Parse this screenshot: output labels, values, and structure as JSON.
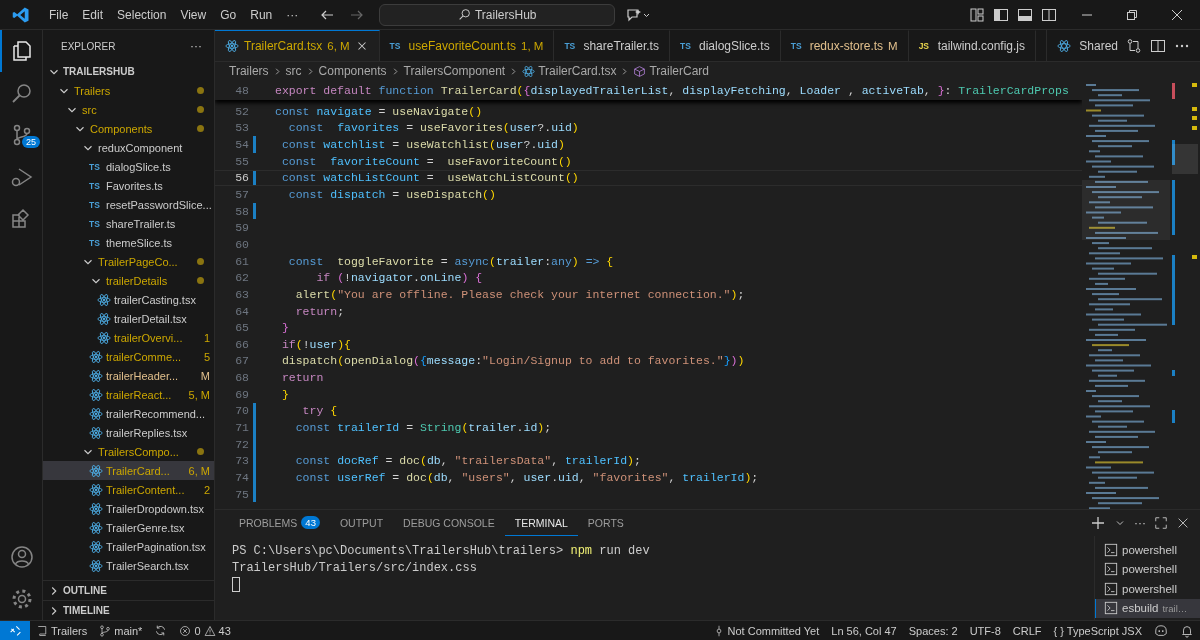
{
  "titlebar": {
    "menu": [
      "File",
      "Edit",
      "Selection",
      "View",
      "Go",
      "Run",
      "···"
    ],
    "search": "TrailersHub"
  },
  "activity": {
    "top": [
      {
        "kind": "explorer",
        "selected": true
      },
      {
        "kind": "search",
        "selected": false
      },
      {
        "kind": "scm",
        "selected": false,
        "badge": "25"
      },
      {
        "kind": "debug",
        "selected": false
      },
      {
        "kind": "extensions",
        "selected": false
      }
    ],
    "bottom": [
      {
        "kind": "account"
      },
      {
        "kind": "settings"
      }
    ]
  },
  "explorer": {
    "title": "EXPLORER",
    "more": "···",
    "root": {
      "label": "TRAILERSHUB",
      "expanded": true
    },
    "tree": [
      {
        "label": "Trailers",
        "kind": "folder",
        "expanded": true,
        "errors": true,
        "dot": true,
        "selected": false,
        "children": [
          {
            "label": "src",
            "kind": "folder",
            "expanded": true,
            "errors": true,
            "dot": true,
            "selected": false,
            "children": [
              {
                "label": "Components",
                "kind": "folder",
                "expanded": true,
                "errors": true,
                "dot": true,
                "selected": false,
                "children": [
                  {
                    "label": "reduxComponent",
                    "kind": "folder",
                    "expanded": true,
                    "errors": false,
                    "modified": false,
                    "dot": false,
                    "selected": false,
                    "children": [
                      {
                        "label": "dialogSlice.ts",
                        "kind": "ts",
                        "icon": "TS",
                        "errors": false,
                        "modified": false,
                        "selected": false
                      },
                      {
                        "label": "Favorites.ts",
                        "kind": "ts",
                        "icon": "TS",
                        "errors": false,
                        "modified": false,
                        "selected": false
                      },
                      {
                        "label": "resetPasswordSlice...",
                        "kind": "ts",
                        "icon": "TS",
                        "errors": false,
                        "modified": false,
                        "selected": false
                      },
                      {
                        "label": "shareTrailer.ts",
                        "kind": "ts",
                        "icon": "TS",
                        "errors": false,
                        "modified": false,
                        "selected": false
                      },
                      {
                        "label": "themeSlice.ts",
                        "kind": "ts",
                        "icon": "TS",
                        "errors": false,
                        "modified": false,
                        "selected": false
                      }
                    ]
                  },
                  {
                    "label": "TrailerPageCo...",
                    "kind": "folder",
                    "expanded": true,
                    "errors": true,
                    "dot": true,
                    "selected": false,
                    "children": [
                      {
                        "label": "trailerDetails",
                        "kind": "folder",
                        "expanded": true,
                        "errors": true,
                        "dot": true,
                        "selected": false,
                        "children": [
                          {
                            "label": "trailerCasting.tsx",
                            "kind": "react",
                            "errors": false,
                            "modified": false,
                            "selected": false
                          },
                          {
                            "label": "trailerDetail.tsx",
                            "kind": "react",
                            "errors": false,
                            "modified": false,
                            "selected": false
                          },
                          {
                            "label": "trailerOvervi...",
                            "kind": "react",
                            "errors": true,
                            "badge": "1",
                            "selected": false
                          }
                        ]
                      },
                      {
                        "label": "trailerComme...",
                        "kind": "react",
                        "errors": true,
                        "badge": "5",
                        "selected": false
                      },
                      {
                        "label": "trailerHeader...",
                        "kind": "react",
                        "errors": false,
                        "modified": true,
                        "badge": "M",
                        "selected": false
                      },
                      {
                        "label": "trailerReact...",
                        "kind": "react",
                        "errors": true,
                        "badge": "5, M",
                        "selected": false
                      },
                      {
                        "label": "trailerRecommend...",
                        "kind": "react",
                        "errors": false,
                        "modified": false,
                        "selected": false
                      },
                      {
                        "label": "trailerReplies.tsx",
                        "kind": "react",
                        "errors": false,
                        "modified": false,
                        "selected": false
                      }
                    ]
                  },
                  {
                    "label": "TrailersCompo...",
                    "kind": "folder",
                    "expanded": true,
                    "errors": true,
                    "dot": true,
                    "selected": false,
                    "children": [
                      {
                        "label": "TrailerCard...",
                        "kind": "react",
                        "errors": true,
                        "badge": "6, M",
                        "selected": true
                      },
                      {
                        "label": "TrailerContent...",
                        "kind": "react",
                        "errors": true,
                        "badge": "2",
                        "selected": false
                      },
                      {
                        "label": "TrailerDropdown.tsx",
                        "kind": "react",
                        "errors": false,
                        "modified": false,
                        "selected": false
                      },
                      {
                        "label": "TrailerGenre.tsx",
                        "kind": "react",
                        "errors": false,
                        "modified": false,
                        "selected": false
                      },
                      {
                        "label": "TrailerPagination.tsx",
                        "kind": "react",
                        "errors": false,
                        "modified": false,
                        "selected": false
                      },
                      {
                        "label": "TrailerSearch.tsx",
                        "kind": "react",
                        "errors": false,
                        "modified": false,
                        "selected": false
                      }
                    ]
                  }
                ]
              }
            ]
          }
        ]
      }
    ],
    "sections": [
      {
        "label": "OUTLINE",
        "expanded": false
      },
      {
        "label": "TIMELINE",
        "expanded": false
      }
    ]
  },
  "tabs": [
    {
      "label": "TrailerCard.tsx",
      "kind": "react",
      "badge": "6, M",
      "errors": true,
      "selected": true
    },
    {
      "label": "useFavoriteCount.ts",
      "kind": "ts",
      "icon": "TS",
      "badge": "1, M",
      "errors": true,
      "selected": false
    },
    {
      "label": "shareTrailer.ts",
      "kind": "ts",
      "icon": "TS",
      "errors": false,
      "modified": false,
      "selected": false
    },
    {
      "label": "dialogSlice.ts",
      "kind": "ts",
      "icon": "TS",
      "errors": false,
      "modified": false,
      "selected": false
    },
    {
      "label": "redux-store.ts",
      "kind": "ts",
      "icon": "TS",
      "badge": "M",
      "errors": false,
      "modified": true,
      "selected": false
    },
    {
      "label": "tailwind.config.js",
      "kind": "js",
      "icon": "JS",
      "errors": false,
      "modified": false,
      "selected": false
    }
  ],
  "shared": "Shared",
  "breadcrumbs": [
    {
      "label": "Trailers",
      "kind": "plain"
    },
    {
      "label": "src",
      "kind": "plain"
    },
    {
      "label": "Components",
      "kind": "plain"
    },
    {
      "label": "TrailersComponent",
      "kind": "plain"
    },
    {
      "label": "TrailerCard.tsx",
      "kind": "react"
    },
    {
      "label": "TrailerCard",
      "kind": "symbol"
    }
  ],
  "code": {
    "sticky": {
      "n": "48",
      "tokens": [
        {
          "kind": "ctrl",
          "text": "export default "
        },
        {
          "kind": "kw",
          "text": "function "
        },
        {
          "kind": "fn",
          "text": "TrailerCard"
        },
        {
          "kind": "br1",
          "text": "("
        },
        {
          "kind": "br2",
          "text": "{"
        },
        {
          "kind": "var",
          "text": "displayedTrailerList"
        },
        {
          "kind": "plain",
          "text": ", "
        },
        {
          "kind": "var",
          "text": "displayFetching"
        },
        {
          "kind": "plain",
          "text": ", "
        },
        {
          "kind": "var",
          "text": "Loader "
        },
        {
          "kind": "plain",
          "text": ", "
        },
        {
          "kind": "var",
          "text": "activeTab"
        },
        {
          "kind": "plain",
          "text": ", "
        },
        {
          "kind": "br2",
          "text": "}"
        },
        {
          "kind": "plain",
          "text": ": "
        },
        {
          "kind": "type",
          "text": "TrailerCardProps"
        }
      ]
    },
    "lines": [
      {
        "n": "52",
        "current": false,
        "changed": false,
        "tokens": [
          {
            "kind": "kw",
            "text": "const "
          },
          {
            "kind": "const",
            "text": "navigate"
          },
          {
            "kind": "plain",
            "text": " = "
          },
          {
            "kind": "fn",
            "text": "useNavigate"
          },
          {
            "kind": "br1",
            "text": "()"
          }
        ]
      },
      {
        "n": "53",
        "current": false,
        "changed": false,
        "tokens": [
          {
            "kind": "kw",
            "text": "  const  "
          },
          {
            "kind": "const",
            "text": "favorites"
          },
          {
            "kind": "plain",
            "text": " = "
          },
          {
            "kind": "fn",
            "text": "useFavorites"
          },
          {
            "kind": "br1",
            "text": "("
          },
          {
            "kind": "var",
            "text": "user"
          },
          {
            "kind": "plain",
            "text": "?."
          },
          {
            "kind": "var",
            "text": "uid"
          },
          {
            "kind": "br1",
            "text": ")"
          }
        ]
      },
      {
        "n": "54",
        "current": false,
        "changed": true,
        "tokens": [
          {
            "kind": "kw",
            "text": " const "
          },
          {
            "kind": "const",
            "text": "watchlist"
          },
          {
            "kind": "plain",
            "text": " = "
          },
          {
            "kind": "fn",
            "text": "useWatchlist"
          },
          {
            "kind": "br1",
            "text": "("
          },
          {
            "kind": "var",
            "text": "user"
          },
          {
            "kind": "plain",
            "text": "?."
          },
          {
            "kind": "var",
            "text": "uid"
          },
          {
            "kind": "br1",
            "text": ")"
          }
        ]
      },
      {
        "n": "55",
        "current": false,
        "changed": false,
        "tokens": [
          {
            "kind": "kw",
            "text": " const  "
          },
          {
            "kind": "const",
            "text": "favoriteCount"
          },
          {
            "kind": "plain",
            "text": " =  "
          },
          {
            "kind": "fn",
            "text": "useFavoriteCount"
          },
          {
            "kind": "br1",
            "text": "()"
          }
        ]
      },
      {
        "n": "56",
        "current": true,
        "changed": true,
        "tokens": [
          {
            "kind": "kw",
            "text": " const "
          },
          {
            "kind": "const",
            "text": "watchListCount"
          },
          {
            "kind": "plain",
            "text": " =  "
          },
          {
            "kind": "fn",
            "text": "useWatchListCount"
          },
          {
            "kind": "br1",
            "text": "()"
          }
        ]
      },
      {
        "n": "57",
        "current": false,
        "changed": false,
        "tokens": [
          {
            "kind": "kw",
            "text": "  const "
          },
          {
            "kind": "const",
            "text": "dispatch"
          },
          {
            "kind": "plain",
            "text": " = "
          },
          {
            "kind": "fn",
            "text": "useDispatch"
          },
          {
            "kind": "br1",
            "text": "()"
          }
        ]
      },
      {
        "n": "58",
        "current": false,
        "changed": true
      },
      {
        "n": "59",
        "current": false,
        "changed": false
      },
      {
        "n": "60",
        "current": false,
        "changed": false
      },
      {
        "n": "61",
        "current": false,
        "changed": false,
        "tokens": [
          {
            "kind": "kw",
            "text": "  const  "
          },
          {
            "kind": "fn",
            "text": "toggleFavorite"
          },
          {
            "kind": "plain",
            "text": " = "
          },
          {
            "kind": "kw",
            "text": "async"
          },
          {
            "kind": "br1",
            "text": "("
          },
          {
            "kind": "var",
            "text": "trailer"
          },
          {
            "kind": "plain",
            "text": ":"
          },
          {
            "kind": "kw",
            "text": "any"
          },
          {
            "kind": "br1",
            "text": ")"
          },
          {
            "kind": "kw",
            "text": " => "
          },
          {
            "kind": "br1",
            "text": "{"
          }
        ]
      },
      {
        "n": "62",
        "current": false,
        "changed": false,
        "tokens": [
          {
            "kind": "ctrl",
            "text": "      if "
          },
          {
            "kind": "br2",
            "text": "("
          },
          {
            "kind": "plain",
            "text": "!"
          },
          {
            "kind": "var",
            "text": "navigator"
          },
          {
            "kind": "plain",
            "text": "."
          },
          {
            "kind": "var",
            "text": "onLine"
          },
          {
            "kind": "br2",
            "text": ") {"
          }
        ]
      },
      {
        "n": "63",
        "current": false,
        "changed": false,
        "tokens": [
          {
            "kind": "fn",
            "text": "   alert"
          },
          {
            "kind": "br1",
            "text": "("
          },
          {
            "kind": "str",
            "text": "\"You are offline. Please check your internet connection.\""
          },
          {
            "kind": "br1",
            "text": ")"
          },
          {
            "kind": "plain",
            "text": ";"
          }
        ]
      },
      {
        "n": "64",
        "current": false,
        "changed": false,
        "tokens": [
          {
            "kind": "ctrl",
            "text": "   return"
          },
          {
            "kind": "plain",
            "text": ";"
          }
        ]
      },
      {
        "n": "65",
        "current": false,
        "changed": false,
        "tokens": [
          {
            "kind": "br2",
            "text": " }"
          }
        ]
      },
      {
        "n": "66",
        "current": false,
        "changed": false,
        "tokens": [
          {
            "kind": "ctrl",
            "text": " if"
          },
          {
            "kind": "br1",
            "text": "("
          },
          {
            "kind": "plain",
            "text": "!"
          },
          {
            "kind": "var",
            "text": "user"
          },
          {
            "kind": "br1",
            "text": "){"
          }
        ]
      },
      {
        "n": "67",
        "current": false,
        "changed": false,
        "tokens": [
          {
            "kind": "fn",
            "text": " dispatch"
          },
          {
            "kind": "br1",
            "text": "("
          },
          {
            "kind": "fn",
            "text": "openDialog"
          },
          {
            "kind": "br2",
            "text": "("
          },
          {
            "kind": "br3",
            "text": "{"
          },
          {
            "kind": "var",
            "text": "message"
          },
          {
            "kind": "plain",
            "text": ":"
          },
          {
            "kind": "str",
            "text": "\"Login/Signup to add to favorites.\""
          },
          {
            "kind": "br3",
            "text": "}"
          },
          {
            "kind": "br2",
            "text": ")"
          },
          {
            "kind": "br1",
            "text": ")"
          }
        ]
      },
      {
        "n": "68",
        "current": false,
        "changed": false,
        "tokens": [
          {
            "kind": "ctrl",
            "text": " return"
          }
        ]
      },
      {
        "n": "69",
        "current": false,
        "changed": false,
        "tokens": [
          {
            "kind": "br1",
            "text": " }"
          }
        ]
      },
      {
        "n": "70",
        "current": false,
        "changed": true,
        "tokens": [
          {
            "kind": "ctrl",
            "text": "    try "
          },
          {
            "kind": "br1",
            "text": "{"
          }
        ]
      },
      {
        "n": "71",
        "current": false,
        "changed": true,
        "tokens": [
          {
            "kind": "kw",
            "text": "   const "
          },
          {
            "kind": "const",
            "text": "trailerId"
          },
          {
            "kind": "plain",
            "text": " = "
          },
          {
            "kind": "type",
            "text": "String"
          },
          {
            "kind": "br1",
            "text": "("
          },
          {
            "kind": "var",
            "text": "trailer"
          },
          {
            "kind": "plain",
            "text": "."
          },
          {
            "kind": "var",
            "text": "id"
          },
          {
            "kind": "br1",
            "text": ")"
          },
          {
            "kind": "plain",
            "text": ";"
          }
        ]
      },
      {
        "n": "72",
        "current": false,
        "changed": true
      },
      {
        "n": "73",
        "current": false,
        "changed": true,
        "tokens": [
          {
            "kind": "kw",
            "text": "   const "
          },
          {
            "kind": "const",
            "text": "docRef"
          },
          {
            "kind": "plain",
            "text": " = "
          },
          {
            "kind": "fn",
            "text": "doc"
          },
          {
            "kind": "br1",
            "text": "("
          },
          {
            "kind": "var",
            "text": "db"
          },
          {
            "kind": "plain",
            "text": ", "
          },
          {
            "kind": "str",
            "text": "\"trailersData\""
          },
          {
            "kind": "plain",
            "text": ", "
          },
          {
            "kind": "const",
            "text": "trailerId"
          },
          {
            "kind": "br1",
            "text": ")"
          },
          {
            "kind": "plain",
            "text": ";"
          }
        ]
      },
      {
        "n": "74",
        "current": false,
        "changed": true,
        "tokens": [
          {
            "kind": "kw",
            "text": "   const "
          },
          {
            "kind": "const",
            "text": "userRef"
          },
          {
            "kind": "plain",
            "text": " = "
          },
          {
            "kind": "fn",
            "text": "doc"
          },
          {
            "kind": "br1",
            "text": "("
          },
          {
            "kind": "var",
            "text": "db"
          },
          {
            "kind": "plain",
            "text": ", "
          },
          {
            "kind": "str",
            "text": "\"users\""
          },
          {
            "kind": "plain",
            "text": ", "
          },
          {
            "kind": "var",
            "text": "user"
          },
          {
            "kind": "plain",
            "text": "."
          },
          {
            "kind": "var",
            "text": "uid"
          },
          {
            "kind": "plain",
            "text": ", "
          },
          {
            "kind": "str",
            "text": "\"favorites\""
          },
          {
            "kind": "plain",
            "text": ", "
          },
          {
            "kind": "const",
            "text": "trailerId"
          },
          {
            "kind": "br1",
            "text": ")"
          },
          {
            "kind": "plain",
            "text": ";"
          }
        ]
      },
      {
        "n": "75",
        "current": false,
        "changed": true
      }
    ]
  },
  "panel": {
    "tabs": [
      {
        "label": "PROBLEMS",
        "badge": "43",
        "selected": false
      },
      {
        "label": "OUTPUT",
        "selected": false
      },
      {
        "label": "DEBUG CONSOLE",
        "selected": false
      },
      {
        "label": "TERMINAL",
        "selected": true
      },
      {
        "label": "PORTS",
        "selected": false
      }
    ],
    "more": "···",
    "terminal": [
      [
        {
          "kind": "plain",
          "text": "PS C:\\Users\\pc\\Documents\\TrailersHub\\trailers> "
        },
        {
          "kind": "cmd",
          "text": "npm"
        },
        {
          "kind": "plain",
          "text": " run dev"
        }
      ],
      [
        {
          "kind": "plain",
          "text": "TrailersHub/Trailers/src/index.css"
        }
      ]
    ],
    "shells": [
      {
        "label": "powershell",
        "selected": false
      },
      {
        "label": "powershell",
        "selected": false
      },
      {
        "label": "powershell",
        "selected": false
      },
      {
        "label": "esbuild",
        "detail": "trail…",
        "selected": true
      }
    ]
  },
  "status": {
    "repo": "Trailers",
    "branch": "main*",
    "errors": "0",
    "warnings": "43",
    "blame": "Not Committed Yet",
    "position": "Ln 56, Col 47",
    "spaces": "Spaces: 2",
    "encoding": "UTF-8",
    "eol": "CRLF",
    "braces": "{ }",
    "language": "TypeScript JSX"
  }
}
